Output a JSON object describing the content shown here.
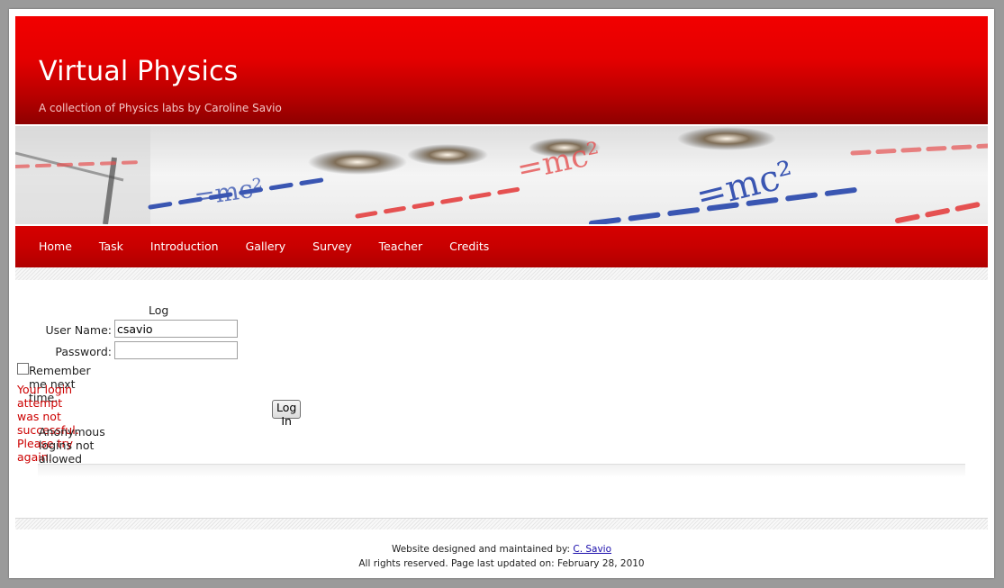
{
  "header": {
    "title": "Virtual Physics",
    "tagline": "A collection of Physics labs by Caroline Savio"
  },
  "banner": {
    "formula_text": "=mc²",
    "colors": {
      "red": "#e23a3a",
      "blue": "#1f3fa8"
    }
  },
  "nav": {
    "items": [
      {
        "label": "Home"
      },
      {
        "label": "Task"
      },
      {
        "label": "Introduction"
      },
      {
        "label": "Gallery"
      },
      {
        "label": "Survey"
      },
      {
        "label": "Teacher"
      },
      {
        "label": "Credits"
      }
    ]
  },
  "login": {
    "title": "Log In",
    "username_label": "User Name:",
    "username_value": "csavio",
    "password_label": "Password:",
    "password_value": "",
    "remember_label": "Remember me next time.",
    "remember_checked": false,
    "error_message": "Your login attempt was not successful. Please try again.",
    "button_label": "Log In",
    "anonymous_note": "Anonymous logins not allowed"
  },
  "footer": {
    "designed_by_text": "Website designed and maintained by:",
    "designer_link": "C. Savio",
    "rights_text": "All rights reserved. Page last updated on: February 28, 2010"
  },
  "colors": {
    "brand_red": "#d40000",
    "error_red": "#cc0000",
    "page_background": "#9a9a9a"
  }
}
